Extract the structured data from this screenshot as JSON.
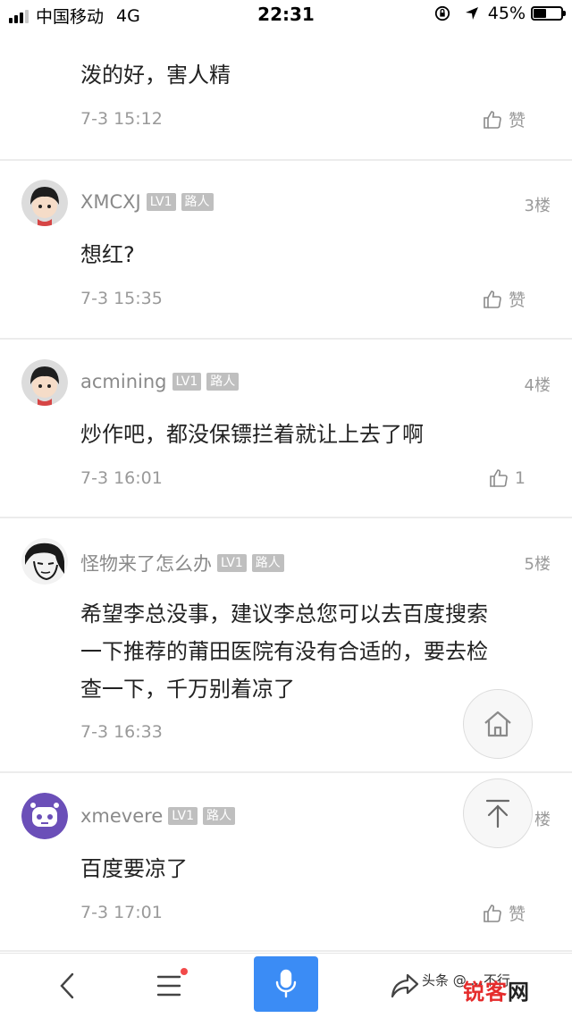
{
  "status_bar": {
    "carrier": "中国移动",
    "network": "4G",
    "time": "22:31",
    "battery": "45%",
    "battery_level": 0.45
  },
  "comments": [
    {
      "username": "",
      "floor": "",
      "content": "泼的好，害人精",
      "time": "7-3 15:12",
      "like_label": "赞",
      "avatar": "boy-avatar-icon"
    },
    {
      "username": "XMCXJ",
      "level": "LV1",
      "role": "路人",
      "floor": "3楼",
      "content": "想红?",
      "time": "7-3 15:35",
      "like_label": "赞",
      "avatar": "boy-avatar-icon"
    },
    {
      "username": "acmining",
      "level": "LV1",
      "role": "路人",
      "floor": "4楼",
      "content": "炒作吧，都没保镖拦着就让上去了啊",
      "time": "7-3 16:01",
      "like_label": "1",
      "avatar": "boy-avatar-icon"
    },
    {
      "username": "怪物来了怎么办",
      "level": "LV1",
      "role": "路人",
      "floor": "5楼",
      "content_lines": [
        "希望李总没事，建议李总您可以去百度搜索",
        "一下推荐的莆田医院有没有合适的，要去检",
        "查一下，千万别着凉了"
      ],
      "time": "7-3 16:33",
      "avatar": "sketch-face-avatar-icon"
    },
    {
      "username": "xmevere",
      "level": "LV1",
      "role": "路人",
      "floor": "楼",
      "content": "百度要凉了",
      "time": "7-3 17:01",
      "like_label": "赞",
      "avatar": "robot-avatar-icon"
    }
  ],
  "floating": {
    "home_icon": "home-icon",
    "top_icon": "back-to-top-icon"
  },
  "bottom_bar": {
    "icons": [
      "back-icon",
      "menu-icon",
      "microphone-icon",
      "share-icon"
    ],
    "accent": "#3b8cf5"
  },
  "watermark": {
    "caption": "头条 @ ...不行",
    "logo_main": "锐客",
    "logo_accent": "网"
  }
}
